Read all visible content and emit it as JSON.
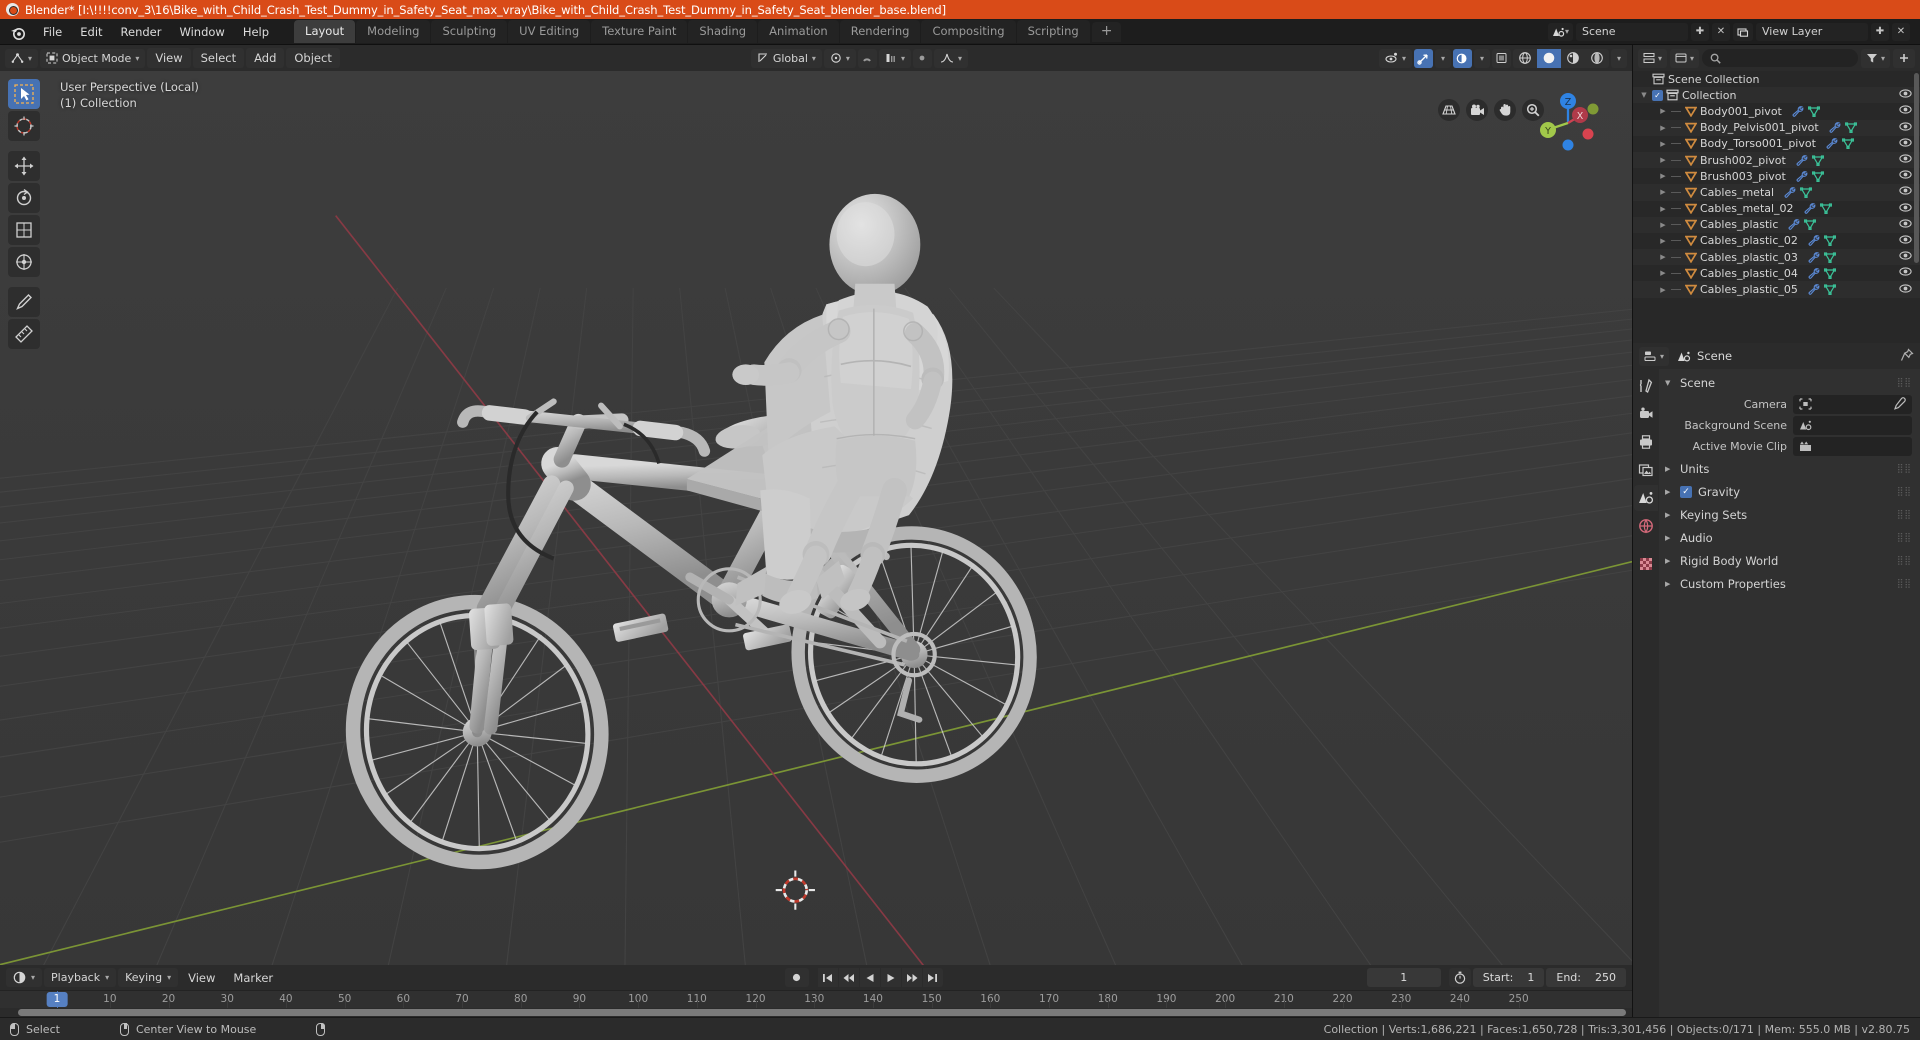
{
  "window": {
    "title": "Blender* [I:\\!!!!conv_3\\16\\Bike_with_Child_Crash_Test_Dummy_in_Safety_Seat_max_vray\\Bike_with_Child_Crash_Test_Dummy_in_Safety_Seat_blender_base.blend]",
    "logo_icon": "blender-logo-icon"
  },
  "topbar": {
    "menus": [
      "File",
      "Edit",
      "Render",
      "Window",
      "Help"
    ],
    "workspaces": [
      {
        "label": "Layout",
        "active": true
      },
      {
        "label": "Modeling",
        "active": false
      },
      {
        "label": "Sculpting",
        "active": false
      },
      {
        "label": "UV Editing",
        "active": false
      },
      {
        "label": "Texture Paint",
        "active": false
      },
      {
        "label": "Shading",
        "active": false
      },
      {
        "label": "Animation",
        "active": false
      },
      {
        "label": "Rendering",
        "active": false
      },
      {
        "label": "Compositing",
        "active": false
      },
      {
        "label": "Scripting",
        "active": false
      }
    ],
    "add_workspace_label": "+",
    "scene_name": "Scene",
    "view_layer_name": "View Layer",
    "scene_icon": "scene-icon",
    "view_layer_icon": "view-layer-icon",
    "new_scene_icon": "new-icon",
    "unlink_scene_icon": "unlink-icon",
    "new_view_layer_icon": "new-icon",
    "remove_view_layer_icon": "remove-icon"
  },
  "viewport_header": {
    "editor_type_icon": "editor-type-3dview-icon",
    "mode_icon": "object-mode-icon",
    "mode": "Object Mode",
    "menus": [
      "View",
      "Select",
      "Add",
      "Object"
    ],
    "transform_orientation_icon": "orientation-global-icon",
    "transform_orientation": "Global",
    "pivot_icon": "pivot-point-icon",
    "snap_magnet_icon": "snap-magnet-icon",
    "snap_target_icon": "snap-increment-icon",
    "proportional_edit_icon": "proportional-edit-icon",
    "proportional_falloff_icon": "falloff-smooth-icon",
    "visibility_icon": "object-types-visibility-icon",
    "gizmo_icon": "gizmo-icon",
    "overlays_icon": "overlays-icon",
    "xray_icon": "xray-toggle-icon",
    "shading_modes": [
      {
        "icon": "shading-wireframe-icon",
        "active": false
      },
      {
        "icon": "shading-solid-icon",
        "active": true
      },
      {
        "icon": "shading-material-icon",
        "active": false
      },
      {
        "icon": "shading-rendered-icon",
        "active": false
      }
    ]
  },
  "viewport": {
    "overlay_line1": "User Perspective (Local)",
    "overlay_line2": "(1) Collection",
    "tools": [
      {
        "name": "tweak-select-box",
        "icon": "cursor-arrow-box-icon",
        "active": true
      },
      {
        "name": "cursor",
        "icon": "3d-cursor-icon",
        "active": false
      },
      {
        "name": "move",
        "icon": "move-arrows-icon",
        "active": false
      },
      {
        "name": "rotate",
        "icon": "rotate-icon",
        "active": false
      },
      {
        "name": "scale",
        "icon": "scale-icon",
        "active": false
      },
      {
        "name": "transform",
        "icon": "transform-icon",
        "active": false
      },
      {
        "name": "annotate",
        "icon": "pencil-icon",
        "active": false
      },
      {
        "name": "measure",
        "icon": "ruler-icon",
        "active": false
      }
    ],
    "nav_buttons": [
      {
        "name": "toggle-orthographic",
        "icon": "grid-perspective-icon"
      },
      {
        "name": "toggle-camera-view",
        "icon": "camera-icon"
      },
      {
        "name": "move-view",
        "icon": "hand-icon"
      },
      {
        "name": "zoom-view",
        "icon": "magnifier-plus-icon"
      }
    ],
    "gizmo_axes": [
      "X",
      "Y",
      "Z"
    ],
    "scene_object": "bicycle with child safety seat and crash test dummy"
  },
  "timeline": {
    "editor_icon": "timeline-editor-icon",
    "menus": [
      {
        "label": "Playback",
        "has_chevron": true
      },
      {
        "label": "Keying",
        "has_chevron": true
      },
      {
        "label": "View",
        "has_chevron": false
      },
      {
        "label": "Marker",
        "has_chevron": false
      }
    ],
    "record_icon": "record-icon",
    "playback_buttons": [
      "jump-to-start-icon",
      "jump-to-prev-keyframe-icon",
      "play-reverse-icon",
      "play-icon",
      "jump-to-next-keyframe-icon",
      "jump-to-end-icon"
    ],
    "current_frame": "1",
    "auto_key_icon": "stopwatch-icon",
    "start_label": "Start:",
    "start_value": "1",
    "end_label": "End:",
    "end_value": "250",
    "ruler_ticks": [
      "10",
      "20",
      "30",
      "40",
      "50",
      "60",
      "70",
      "80",
      "90",
      "100",
      "110",
      "120",
      "130",
      "140",
      "150",
      "160",
      "170",
      "180",
      "190",
      "200",
      "210",
      "220",
      "230",
      "240",
      "250"
    ],
    "playhead_label": "1"
  },
  "outliner": {
    "display_mode_icon": "outliner-display-mode-icon",
    "filter_icon": "filter-funnel-icon",
    "search_icon": "search-icon",
    "new_collection_icon": "new-collection-icon",
    "root": {
      "label": "Scene Collection",
      "icon": "scene-collection-icon"
    },
    "collection": {
      "label": "Collection",
      "icon": "collection-icon",
      "checked": true,
      "expanded": true
    },
    "items": [
      {
        "label": "Body001_pivot",
        "icon": "empty-plain-axes-icon",
        "modifier_icon": "wrench-icon",
        "data_icon": "mesh-data-icon"
      },
      {
        "label": "Body_Pelvis001_pivot",
        "icon": "empty-plain-axes-icon",
        "modifier_icon": "wrench-icon",
        "data_icon": "mesh-data-icon"
      },
      {
        "label": "Body_Torso001_pivot",
        "icon": "empty-plain-axes-icon",
        "modifier_icon": "wrench-icon",
        "data_icon": "mesh-data-icon"
      },
      {
        "label": "Brush002_pivot",
        "icon": "empty-plain-axes-icon",
        "modifier_icon": "wrench-icon",
        "data_icon": "mesh-data-icon"
      },
      {
        "label": "Brush003_pivot",
        "icon": "empty-plain-axes-icon",
        "modifier_icon": "wrench-icon",
        "data_icon": "mesh-data-icon"
      },
      {
        "label": "Cables_metal",
        "icon": "empty-plain-axes-icon",
        "modifier_icon": "wrench-icon",
        "data_icon": "mesh-data-icon"
      },
      {
        "label": "Cables_metal_02",
        "icon": "empty-plain-axes-icon",
        "modifier_icon": "wrench-icon",
        "data_icon": "mesh-data-icon"
      },
      {
        "label": "Cables_plastic",
        "icon": "empty-plain-axes-icon",
        "modifier_icon": "wrench-icon",
        "data_icon": "mesh-data-icon"
      },
      {
        "label": "Cables_plastic_02",
        "icon": "empty-plain-axes-icon",
        "modifier_icon": "wrench-icon",
        "data_icon": "mesh-data-icon"
      },
      {
        "label": "Cables_plastic_03",
        "icon": "empty-plain-axes-icon",
        "modifier_icon": "wrench-icon",
        "data_icon": "mesh-data-icon"
      },
      {
        "label": "Cables_plastic_04",
        "icon": "empty-plain-axes-icon",
        "modifier_icon": "wrench-icon",
        "data_icon": "mesh-data-icon"
      },
      {
        "label": "Cables_plastic_05",
        "icon": "empty-plain-axes-icon",
        "modifier_icon": "wrench-icon",
        "data_icon": "mesh-data-icon"
      }
    ],
    "visibility_icon": "eye-icon"
  },
  "properties": {
    "editor_icon": "properties-editor-icon",
    "breadcrumb_icon": "scene-icon",
    "breadcrumb": "Scene",
    "pin_icon": "pin-icon",
    "tabs": [
      {
        "name": "tool",
        "icon": "tool-screwdriver-wrench-icon",
        "active": false
      },
      {
        "name": "render",
        "icon": "render-camera-back-icon",
        "active": false
      },
      {
        "name": "output",
        "icon": "output-printer-icon",
        "active": false
      },
      {
        "name": "view-layer",
        "icon": "view-layer-images-icon",
        "active": false
      },
      {
        "name": "scene",
        "icon": "scene-cone-sphere-icon",
        "active": true
      },
      {
        "name": "world",
        "icon": "world-globe-icon",
        "active": false
      },
      {
        "name": "texture",
        "icon": "texture-checker-icon",
        "active": false
      }
    ],
    "panels": [
      {
        "label": "Scene",
        "expanded": true,
        "checkbox": null
      },
      {
        "label": "Units",
        "expanded": false,
        "checkbox": null
      },
      {
        "label": "Gravity",
        "expanded": false,
        "checkbox": true
      },
      {
        "label": "Keying Sets",
        "expanded": false,
        "checkbox": null
      },
      {
        "label": "Audio",
        "expanded": false,
        "checkbox": null
      },
      {
        "label": "Rigid Body World",
        "expanded": false,
        "checkbox": null
      },
      {
        "label": "Custom Properties",
        "expanded": false,
        "checkbox": null
      }
    ],
    "scene_fields": [
      {
        "label": "Camera",
        "value": "",
        "icon": "camera-data-icon",
        "eyedropper": true
      },
      {
        "label": "Background Scene",
        "value": "",
        "icon": "scene-icon",
        "eyedropper": false
      },
      {
        "label": "Active Movie Clip",
        "value": "",
        "icon": "movie-clip-icon",
        "eyedropper": false
      }
    ]
  },
  "statusbar": {
    "hints": [
      {
        "label": "Select",
        "mouse": "left"
      },
      {
        "label": "Center View to Mouse",
        "mouse": "middle"
      },
      {
        "label": "",
        "mouse": "right"
      }
    ],
    "stats": "Collection | Verts:1,686,221 | Faces:1,650,728 | Tris:3,301,456 | Objects:0/171 | Mem: 555.0 MB | v2.80.75"
  },
  "colors": {
    "title_bar": "#d94b18",
    "accent_blue": "#4772b3",
    "viewport_bg": "#393939",
    "panel_bg": "#303030",
    "header_bg": "#2b2b2b",
    "axis_x_red": "#cc4352",
    "axis_y_green": "#a1c84a",
    "axis_z_blue": "#2f83e3",
    "empty_orange": "#d08b3f"
  }
}
